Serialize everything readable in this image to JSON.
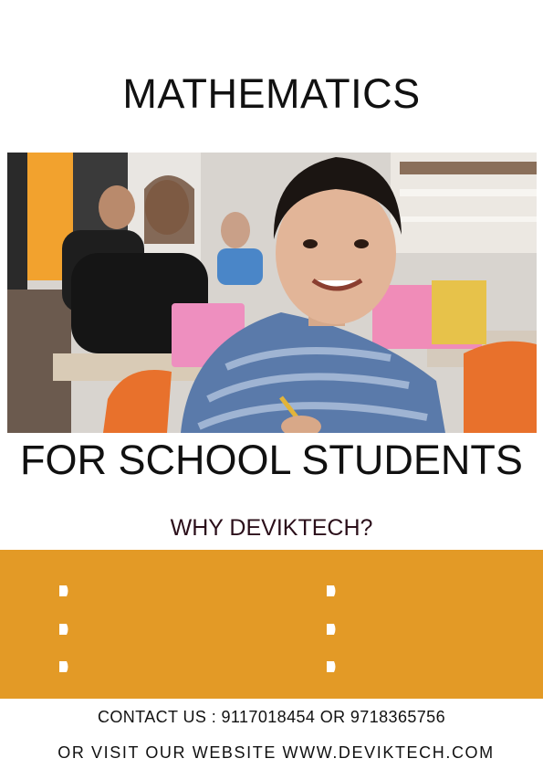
{
  "title": "MATHEMATICS",
  "subtitle": "FOR SCHOOL STUDENTS",
  "why_heading": "WHY DEVIKTECH?",
  "features": {
    "left_bullets": [
      "",
      "",
      ""
    ],
    "right_bullets": [
      "",
      "",
      ""
    ],
    "bullet_icon": "play-bullet-icon",
    "band_color": "#e39a26"
  },
  "contact_line": "CONTACT US : 9117018454 OR 9718365756",
  "website_line": "OR VISIT OUR WEBSITE WWW.DEVIKTECH.COM"
}
